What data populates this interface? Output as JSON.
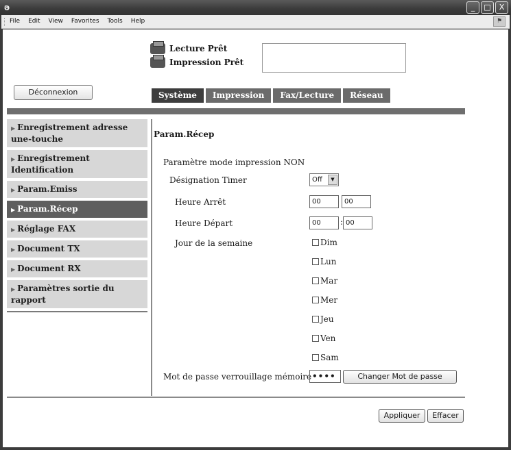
{
  "window": {
    "icon_glyph": "ə",
    "buttons": {
      "minimize": "_",
      "maximize": "□",
      "close": "X"
    }
  },
  "menu": [
    "File",
    "Edit",
    "View",
    "Favorites",
    "Tools",
    "Help"
  ],
  "status": {
    "scan": "Lecture Prêt",
    "print": "Impression Prêt"
  },
  "logout_label": "Déconnexion",
  "tabs": [
    "Système",
    "Impression",
    "Fax/Lecture",
    "Réseau"
  ],
  "sidebar": {
    "arrow": "▶",
    "items": [
      "Enregistrement adresse une-touche",
      "Enregistrement Identification",
      "Param.Emiss",
      "Param.Récep",
      "Réglage FAX",
      "Document TX",
      "Document RX",
      "Paramètres sortie du rapport"
    ],
    "active_index": 3
  },
  "main": {
    "title": "Param.Récep",
    "section": "Paramètre mode impression NON",
    "timer_label": "Désignation Timer",
    "timer_value": "Off",
    "timer_arrow": "▼",
    "stop_label": "Heure Arrêt",
    "stop_hh": "00",
    "stop_mm": "00",
    "start_label": "Heure Départ",
    "start_hh": "00",
    "start_mm": "00",
    "time_sep": ":",
    "weekday_label": "Jour de la semaine",
    "days": [
      "Dim",
      "Lun",
      "Mar",
      "Mer",
      "Jeu",
      "Ven",
      "Sam"
    ],
    "password_label": "Mot de passe verrouillage mémoire",
    "password_value": "••••",
    "change_password_label": "Changer Mot de passe",
    "apply_label": "Appliquer",
    "clear_label": "Effacer"
  }
}
